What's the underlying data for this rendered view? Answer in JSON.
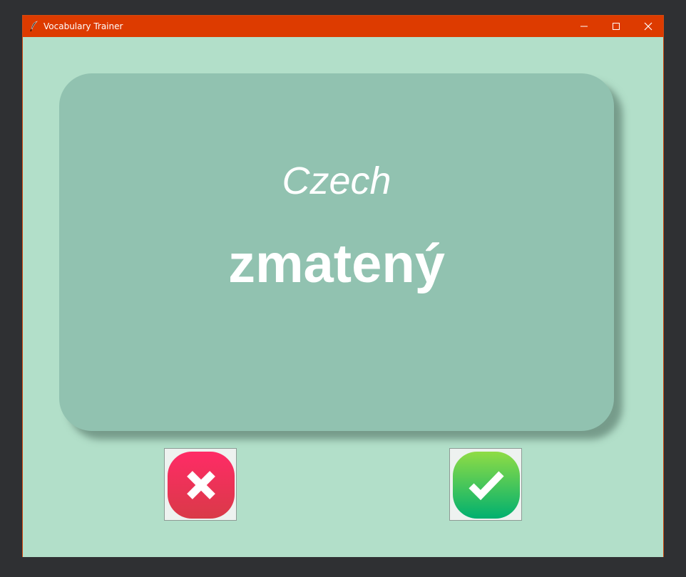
{
  "window": {
    "title": "Vocabulary Trainer",
    "titlebar_color": "#dd3b00",
    "background_color": "#b2dfc9"
  },
  "titlebar_icons": {
    "app": "feather-icon",
    "minimize": "minimize-icon",
    "maximize": "maximize-icon",
    "close": "close-icon"
  },
  "card": {
    "language": "Czech",
    "word": "zmatený",
    "color": "#91c2b0"
  },
  "buttons": {
    "wrong": {
      "icon": "cross-icon",
      "color": "#e8304f"
    },
    "right": {
      "icon": "checkmark-icon",
      "color": "#27c05a"
    }
  }
}
